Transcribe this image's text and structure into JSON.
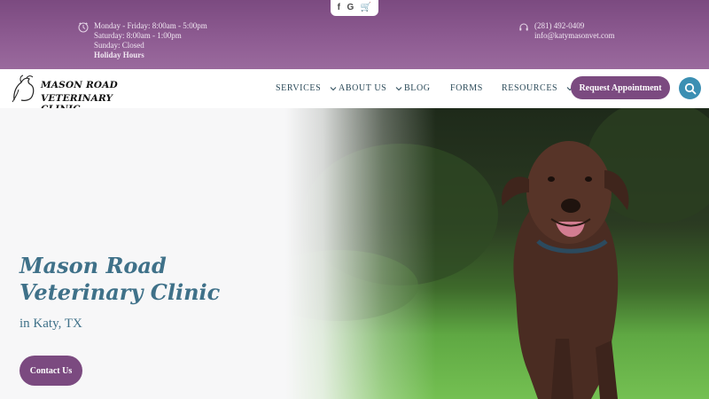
{
  "topbar": {
    "social": [
      "f",
      "G",
      "🛒"
    ],
    "hours": [
      "Monday - Friday: 8:00am - 5:00pm",
      "Saturday: 8:00am - 1:00pm",
      "Sunday: Closed"
    ],
    "holiday_link": "Holiday Hours",
    "phone": "(281) 492-0409",
    "email": "info@katymasonvet.com"
  },
  "logo": {
    "line1": "MASON ROAD",
    "line2": "VETERINARY CLINIC"
  },
  "nav": {
    "services": "SERVICES",
    "about": "ABOUT US",
    "blog": "BLOG",
    "forms": "FORMS",
    "resources": "RESOURCES",
    "cta": "Request Appointment"
  },
  "hero": {
    "title_line1": "Mason Road",
    "title_line2": "Veterinary Clinic",
    "subtitle": "in Katy, TX",
    "button": "Contact Us"
  },
  "colors": {
    "brand_purple": "#7b4a80",
    "accent_blue": "#3b8fb3",
    "heading_blue": "#3f7189"
  },
  "icons": [
    "facebook-icon",
    "google-icon",
    "cart-icon",
    "clock-icon",
    "headset-icon",
    "search-icon",
    "chevron-down-icon"
  ]
}
